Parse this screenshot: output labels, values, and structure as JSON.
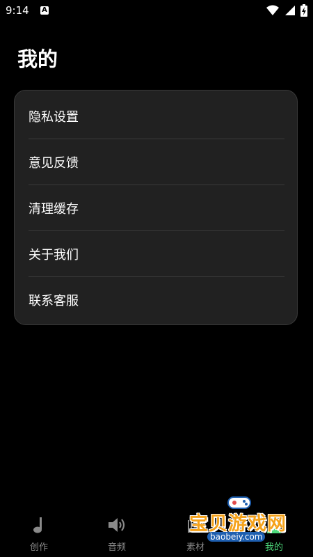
{
  "status_bar": {
    "time": "9:14",
    "notification_icon": "a-badge-icon",
    "icons": [
      "wifi-icon",
      "signal-icon",
      "battery-charging-icon"
    ]
  },
  "page": {
    "title": "我的"
  },
  "menu": {
    "items": [
      {
        "label": "隐私设置"
      },
      {
        "label": "意见反馈"
      },
      {
        "label": "清理缓存"
      },
      {
        "label": "关于我们"
      },
      {
        "label": "联系客服"
      }
    ]
  },
  "bottom_nav": {
    "items": [
      {
        "label": "创作",
        "icon": "music-note-icon"
      },
      {
        "label": "音频",
        "icon": "speaker-icon"
      },
      {
        "label": "素材",
        "icon": "layers-icon"
      },
      {
        "label": "我的",
        "icon": "person-icon",
        "active": true
      }
    ]
  },
  "watermark": {
    "main": "宝贝游戏网",
    "url": "baobeiy.com"
  },
  "colors": {
    "accent": "#4cd97b",
    "card_bg": "#212121",
    "background": "#000000"
  }
}
